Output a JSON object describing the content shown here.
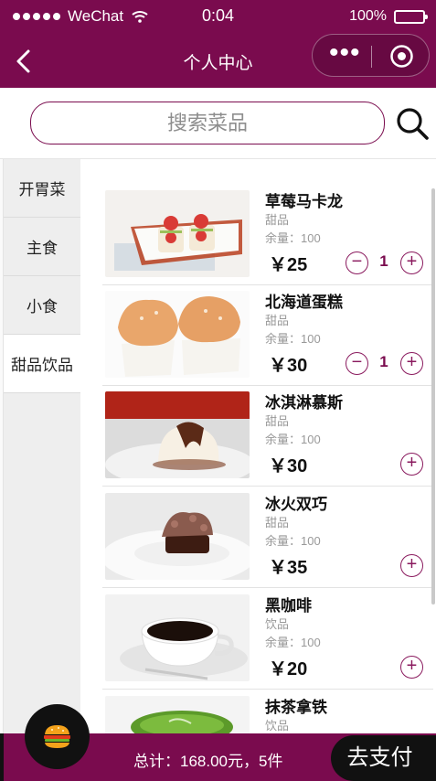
{
  "status_bar": {
    "carrier": "WeChat",
    "time": "0:04",
    "battery": "100%"
  },
  "nav": {
    "title": "个人中心"
  },
  "search": {
    "placeholder": "搜索菜品"
  },
  "categories": [
    {
      "label": "开胃菜",
      "active": false
    },
    {
      "label": "主食",
      "active": false
    },
    {
      "label": "小食",
      "active": false
    },
    {
      "label": "甜品饮品",
      "active": true
    }
  ],
  "items": [
    {
      "name": "草莓马卡龙",
      "type": "甜品",
      "stock": "余量：100",
      "price": "￥25",
      "qty": "1",
      "image": "strawberry-macaron-photo"
    },
    {
      "name": "北海道蛋糕",
      "type": "甜品",
      "stock": "余量：100",
      "price": "￥30",
      "qty": "1",
      "image": "hokkaido-cake-photo"
    },
    {
      "name": "冰淇淋慕斯",
      "type": "甜品",
      "stock": "余量：100",
      "price": "￥30",
      "qty": "",
      "image": "ice-cream-mousse-photo"
    },
    {
      "name": "冰火双巧",
      "type": "甜品",
      "stock": "余量：100",
      "price": "￥35",
      "qty": "",
      "image": "chocolate-dessert-photo"
    },
    {
      "name": "黑咖啡",
      "type": "饮品",
      "stock": "余量：100",
      "price": "￥20",
      "qty": "",
      "image": "black-coffee-photo"
    },
    {
      "name": "抹茶拿铁",
      "type": "饮品",
      "stock": "",
      "price": "",
      "qty": "",
      "image": "matcha-latte-photo"
    }
  ],
  "footer": {
    "total": "总计：168.00元，5件",
    "pay_label": "去支付"
  },
  "colors": {
    "brand": "#7a0b4e",
    "accent": "#8a1a5e",
    "dark": "#111111"
  }
}
